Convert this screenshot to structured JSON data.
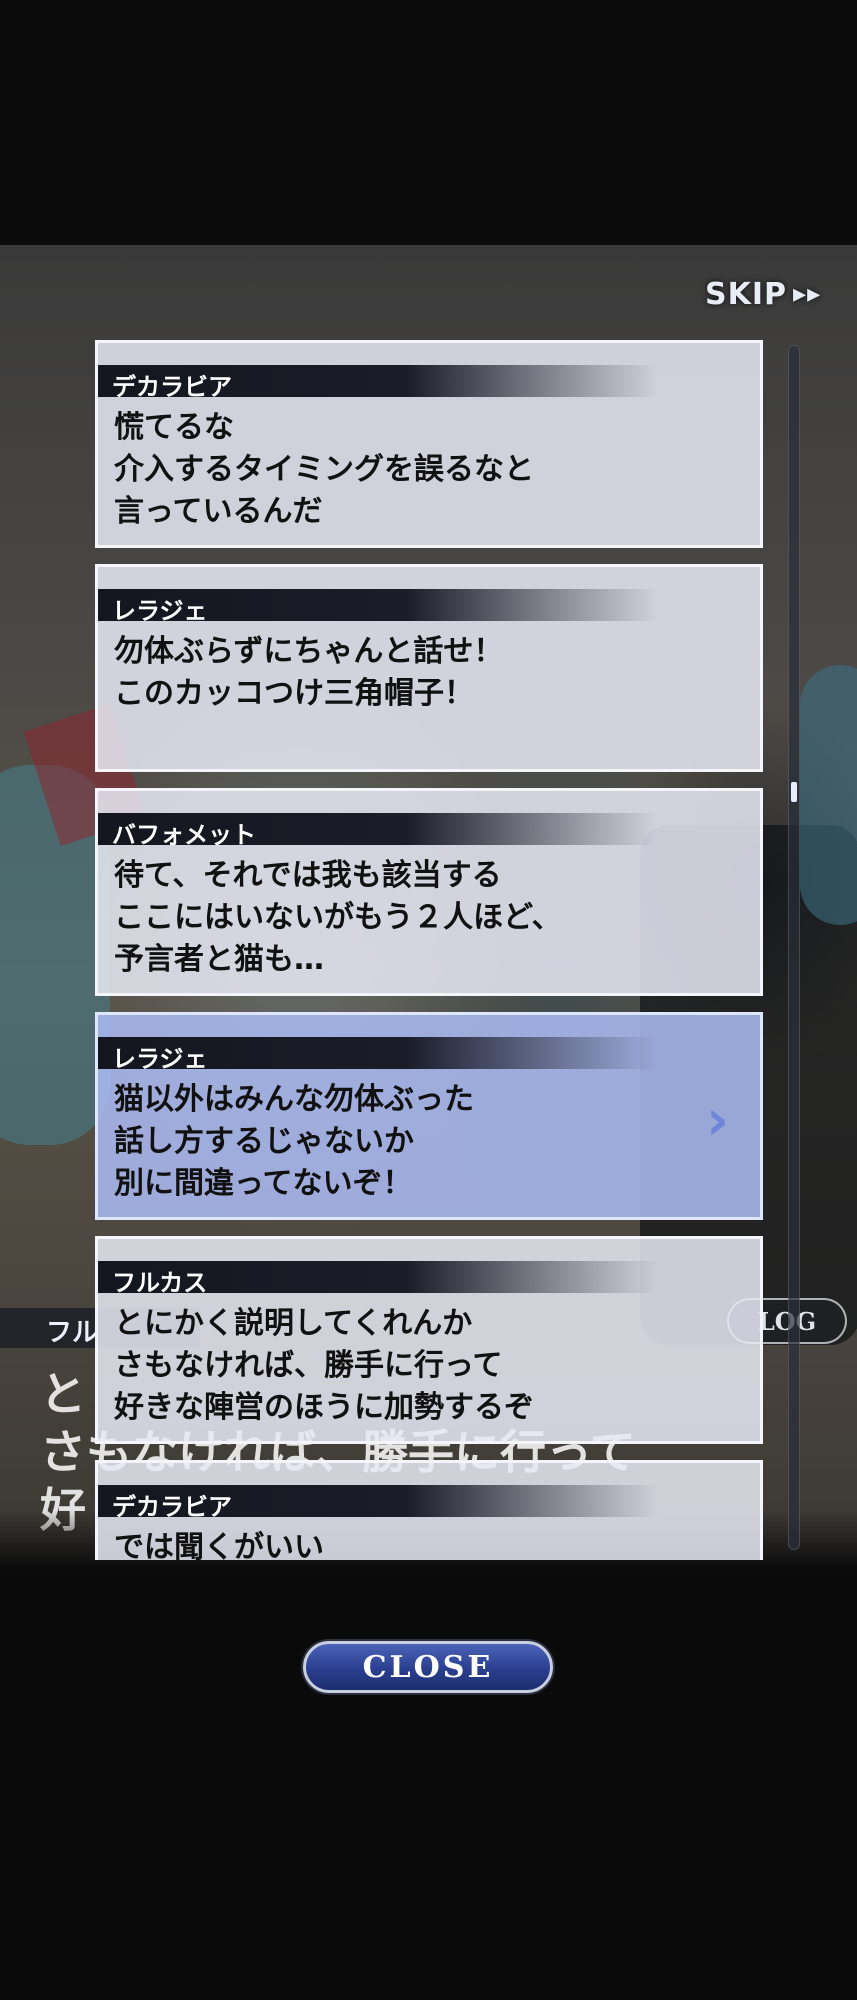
{
  "header": {
    "skip_label": "SKIP"
  },
  "background_dialog": {
    "speaker": "フル",
    "log_label": "LOG",
    "text_lines": [
      "と",
      "さもなければ、勝手に行って",
      "好"
    ]
  },
  "log": {
    "entries": [
      {
        "speaker": "デカラビア",
        "lines": [
          "慌てるな",
          "介入するタイミングを誤るなと",
          "言っているんだ"
        ]
      },
      {
        "speaker": "レラジェ",
        "lines": [
          "勿体ぶらずにちゃんと話せ！",
          "このカッコつけ三角帽子！"
        ]
      },
      {
        "speaker": "バフォメット",
        "lines": [
          "待て、それでは我も該当する",
          "ここにはいないがもう２人ほど、",
          "予言者と猫も…"
        ]
      },
      {
        "speaker": "レラジェ",
        "lines": [
          "猫以外はみんな勿体ぶった",
          "話し方するじゃないか",
          "別に間違ってないぞ！"
        ],
        "active": true,
        "arrow": "›"
      },
      {
        "speaker": "フルカス",
        "lines": [
          "とにかく説明してくれんか",
          "さもなければ、勝手に行って",
          "好きな陣営のほうに加勢するぞ"
        ]
      },
      {
        "speaker": "デカラビア",
        "lines": [
          "では聞くがいい"
        ]
      }
    ]
  },
  "footer": {
    "close_label": "CLOSE"
  },
  "colors": {
    "accent": "#2a3f8f",
    "active_entry": "#aab9f0"
  }
}
